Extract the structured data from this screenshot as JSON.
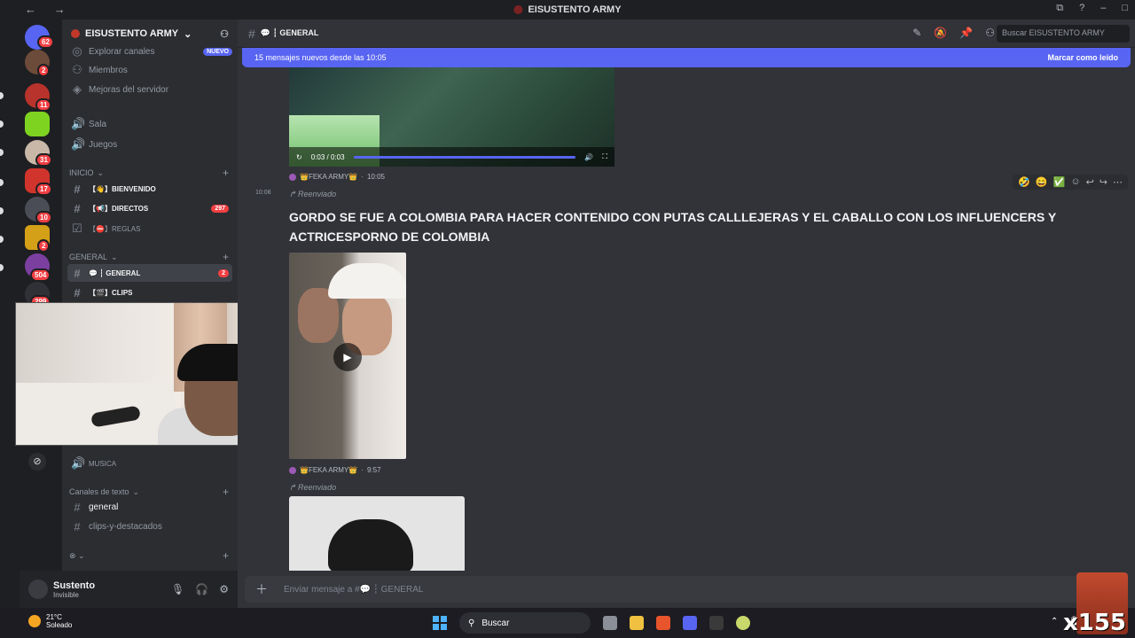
{
  "window": {
    "title": "EISUSTENTO ARMY",
    "nav_arrows": "←  →",
    "controls": [
      "⧉",
      "?",
      "–",
      "□"
    ]
  },
  "rail": {
    "servers": [
      {
        "badge": "62",
        "color": "#5865f2"
      },
      {
        "badge": "2",
        "color": "#6d4b3a"
      },
      {
        "badge": "11",
        "color": "#b8332b"
      },
      {
        "badge": "",
        "color": "#7ed321"
      },
      {
        "badge": "31",
        "color": "#c9b8a8"
      },
      {
        "badge": "17",
        "color": "#d0342c"
      },
      {
        "badge": "10",
        "color": "#4a4d55"
      },
      {
        "badge": "2",
        "color": "#d4a017"
      },
      {
        "badge": "504",
        "color": "#7b3fa0"
      },
      {
        "badge": "299",
        "color": "#2f3136"
      }
    ]
  },
  "sidebar": {
    "guild_name": "EISUSTENTO ARMY",
    "items": [
      {
        "label": "Explorar canales",
        "tag": "NUEVO"
      },
      {
        "label": "Miembros"
      },
      {
        "label": "Mejoras del servidor"
      },
      {
        "label": "Sala"
      },
      {
        "label": "Juegos"
      }
    ],
    "cat_inicio": "INICIO",
    "inicio_channels": [
      {
        "label": "【👋】BIENVENIDO",
        "count": ""
      },
      {
        "label": "【📢】DIRECTOS",
        "count": "297"
      },
      {
        "label": "【⛔】REGLAS",
        "count": ""
      }
    ],
    "cat_general": "GENERAL",
    "general_channels": [
      {
        "label": "💬 ┆ GENERAL",
        "count": "2"
      },
      {
        "label": "【🎬】CLIPS",
        "count": ""
      }
    ],
    "musica_label": "MUSICA",
    "cat_text": "Canales de texto",
    "text_channels": [
      {
        "label": "general"
      },
      {
        "label": "clips-y-destacados"
      }
    ]
  },
  "user": {
    "name": "Sustento",
    "status": "Invisible"
  },
  "header": {
    "channel": "💬 ┆ GENERAL",
    "search_placeholder": "Buscar EISUSTENTO ARMY"
  },
  "banner": {
    "text": "15 mensajes nuevos desde las 10:05",
    "action": "Marcar como leído"
  },
  "video1": {
    "time": "0:03 / 0:03"
  },
  "messages": [
    {
      "author": "👑FEKA ARMY👑",
      "time": "10:05",
      "forwarded": "Reenviado"
    },
    {
      "timestamp": "10:08",
      "text": "GORDO SE FUE A COLOMBIA PARA HACER CONTENIDO CON PUTAS CALLLEJERAS Y EL CABALLO CON LOS INFLUENCERS Y ACTRICESPORNO DE COLOMBIA"
    },
    {
      "author": "👑FEKA ARMY👑",
      "time": "9:57",
      "forwarded": "Reenviado"
    }
  ],
  "composer": {
    "placeholder": "Enviar mensaje a #💬 ┆ GENERAL"
  },
  "taskbar": {
    "temp": "21°C",
    "weather": "Soleado",
    "search": "Buscar"
  },
  "overlay": {
    "text": "x155"
  }
}
